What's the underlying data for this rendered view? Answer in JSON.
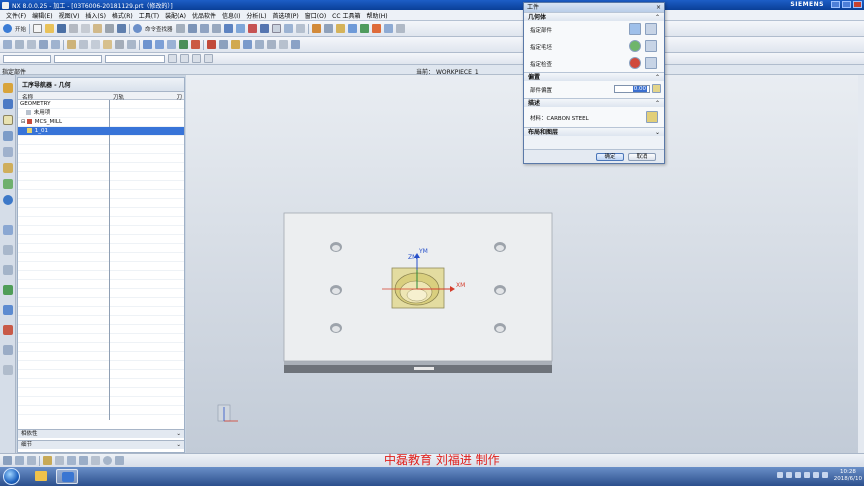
{
  "window": {
    "title": "NX 8.0.0.25 - 加工 - [03T6006-20181129.prt（修改的）]",
    "brand": "SIEMENS"
  },
  "menubar": [
    "文件(F)",
    "编辑(E)",
    "视图(V)",
    "插入(S)",
    "格式(R)",
    "工具(T)",
    "装配(A)",
    "优品软件",
    "信息(I)",
    "分析(L)",
    "首选项(P)",
    "窗口(O)",
    "CC 工具箱",
    "帮助(H)"
  ],
  "toolbar": {
    "start_label": "开始",
    "command_finder_label": "命令查找器"
  },
  "infostrip": {
    "left": "指定部件",
    "current_label": "当前：",
    "current_value": "WORKPIECE_1"
  },
  "navigator": {
    "title": "工序导航器 - 几何",
    "columns": [
      "名称",
      "刀轨",
      "刀"
    ],
    "rows": [
      {
        "label": "GEOMETRY",
        "indent": 0,
        "selected": false
      },
      {
        "label": "未用项",
        "indent": 1,
        "selected": false
      },
      {
        "label": "MCS_MILL",
        "indent": 1,
        "selected": false
      },
      {
        "label": "1_01",
        "indent": 2,
        "selected": true
      }
    ],
    "footer": [
      {
        "label": "相依性"
      },
      {
        "label": "细节"
      }
    ]
  },
  "model": {
    "labels": {
      "ym": "YM",
      "zm": "ZM",
      "xm": "XM"
    }
  },
  "dialog": {
    "title": "工件",
    "sections": {
      "geometry_body": "几何体",
      "offset": "偏置",
      "description": "描述",
      "layout_layer": "布局和图层"
    },
    "rows": {
      "specify_part": "指定部件",
      "specify_blank": "指定毛坯",
      "specify_check": "指定检查",
      "part_offset": "部件偏置",
      "part_offset_value": "0.00",
      "material": "材料：CARBON STEEL"
    },
    "ok": "确定",
    "cancel": "取消"
  },
  "watermark": "中磊教育  刘福进  制作",
  "clock": {
    "time": "10:28",
    "date": "2018/6/10"
  },
  "colors": {
    "titlebar": "#1550b8",
    "selection": "#3874d8",
    "model_plate": "#eceef0",
    "model_core": "#e3dca0",
    "watermark": "#e0201c"
  }
}
